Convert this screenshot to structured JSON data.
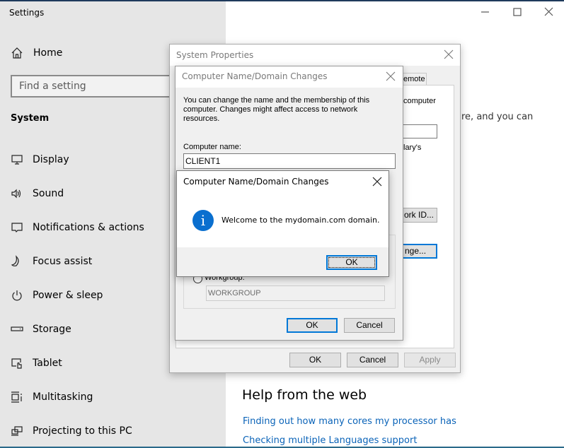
{
  "settings": {
    "app_title": "Settings",
    "home_label": "Home",
    "search_placeholder": "Find a setting",
    "section_title": "System",
    "nav_items": [
      {
        "label": "Display",
        "icon": "monitor-icon"
      },
      {
        "label": "Sound",
        "icon": "speaker-icon"
      },
      {
        "label": "Notifications & actions",
        "icon": "notification-icon"
      },
      {
        "label": "Focus assist",
        "icon": "moon-icon"
      },
      {
        "label": "Power & sleep",
        "icon": "power-icon"
      },
      {
        "label": "Storage",
        "icon": "storage-icon"
      },
      {
        "label": "Tablet",
        "icon": "tablet-icon"
      },
      {
        "label": "Multitasking",
        "icon": "multitasking-icon"
      },
      {
        "label": "Projecting to this PC",
        "icon": "projecting-icon"
      }
    ],
    "bg_text_fragment": "re, and you can",
    "help": {
      "title": "Help from the web",
      "links": [
        "Finding out how many cores my processor has",
        "Checking multiple Languages support"
      ]
    }
  },
  "system_properties": {
    "title": "System Properties",
    "tab_partial": "emote",
    "partial_text_1": "computer",
    "partial_text_2": "lary's",
    "network_id_partial": "ork ID...",
    "change_partial": "nge...",
    "buttons": {
      "ok": "OK",
      "cancel": "Cancel",
      "apply": "Apply"
    }
  },
  "computer_name_dialog": {
    "title": "Computer Name/Domain Changes",
    "description": "You can change the name and the membership of this computer. Changes might affect access to network resources.",
    "computer_name_label": "Computer name:",
    "computer_name_value": "CLIENT1",
    "workgroup_label": "Workgroup:",
    "workgroup_value": "WORKGROUP",
    "buttons": {
      "ok": "OK",
      "cancel": "Cancel"
    }
  },
  "message_box": {
    "title": "Computer Name/Domain Changes",
    "icon": "info-icon",
    "message": "Welcome to the mydomain.com domain.",
    "ok_label": "OK"
  },
  "colors": {
    "accent": "#0078d7",
    "link": "#0a63b8",
    "info": "#0a6fcf"
  }
}
